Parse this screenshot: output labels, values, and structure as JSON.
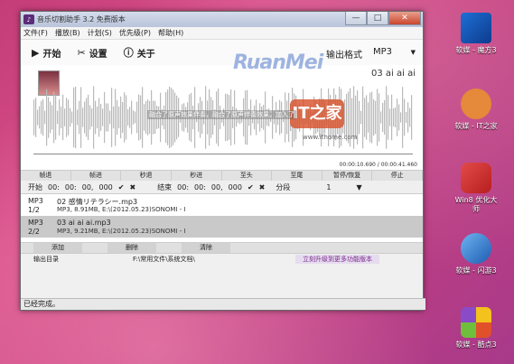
{
  "window": {
    "title": "音乐切割助手 3.2 免费版本",
    "buttons": {
      "minimize": "—",
      "maximize": "□",
      "close": "✕"
    }
  },
  "menu": [
    "文件(F)",
    "播放(B)",
    "计划(S)",
    "优先级(P)",
    "帮助(H)"
  ],
  "toolbar": {
    "start": "开始",
    "settings": "设置",
    "about": "关于",
    "format_label": "输出格式",
    "format_value": "MP3"
  },
  "watermark": "RuanMei",
  "player": {
    "song_title": "03 ai ai ai",
    "wave_text": "融合了原声效果伴奏，融合了原声伴奏效果，加入了",
    "ithome": "IT之家",
    "ithome_url": "www.ithome.com",
    "time_readout": "00:00:10.690 / 00:00:41.460"
  },
  "controls": [
    "帧退",
    "帧进",
    "秒退",
    "秒进",
    "至头",
    "至尾",
    "暂停/恢复",
    "停止"
  ],
  "range": {
    "start_label": "开始",
    "start_h": "00:",
    "start_m": "00:",
    "start_s": "00,",
    "start_ms": "000",
    "end_label": "结束",
    "end_h": "00:",
    "end_m": "00:",
    "end_s": "00,",
    "end_ms": "000",
    "segment_label": "分段",
    "segment_value": "1"
  },
  "list": [
    {
      "format": "MP3",
      "index": "1/2",
      "name": "02 感情リテラシー.mp3",
      "info": "MP3, 8.91MB, E:\\(2012.05.23)SONOMI - I"
    },
    {
      "format": "MP3",
      "index": "2/2",
      "name": "03 ai ai ai.mp3",
      "info": "MP3, 9.21MB, E:\\(2012.05.23)SONOMI - I"
    }
  ],
  "actions": [
    "添加",
    "删除",
    "清除"
  ],
  "output": {
    "label": "输出目录",
    "path": "F:\\常用文件\\系统文档\\",
    "upgrade": "立刻升级到更多功能版本"
  },
  "status": "已经完成。",
  "desktop": [
    {
      "label": "软媒 - 魔方3"
    },
    {
      "label": "软媒 - IT之家"
    },
    {
      "label": "Win8 优化大师"
    },
    {
      "label": "软媒 - 闪游3"
    },
    {
      "label": "软媒 - 酷点3"
    }
  ]
}
